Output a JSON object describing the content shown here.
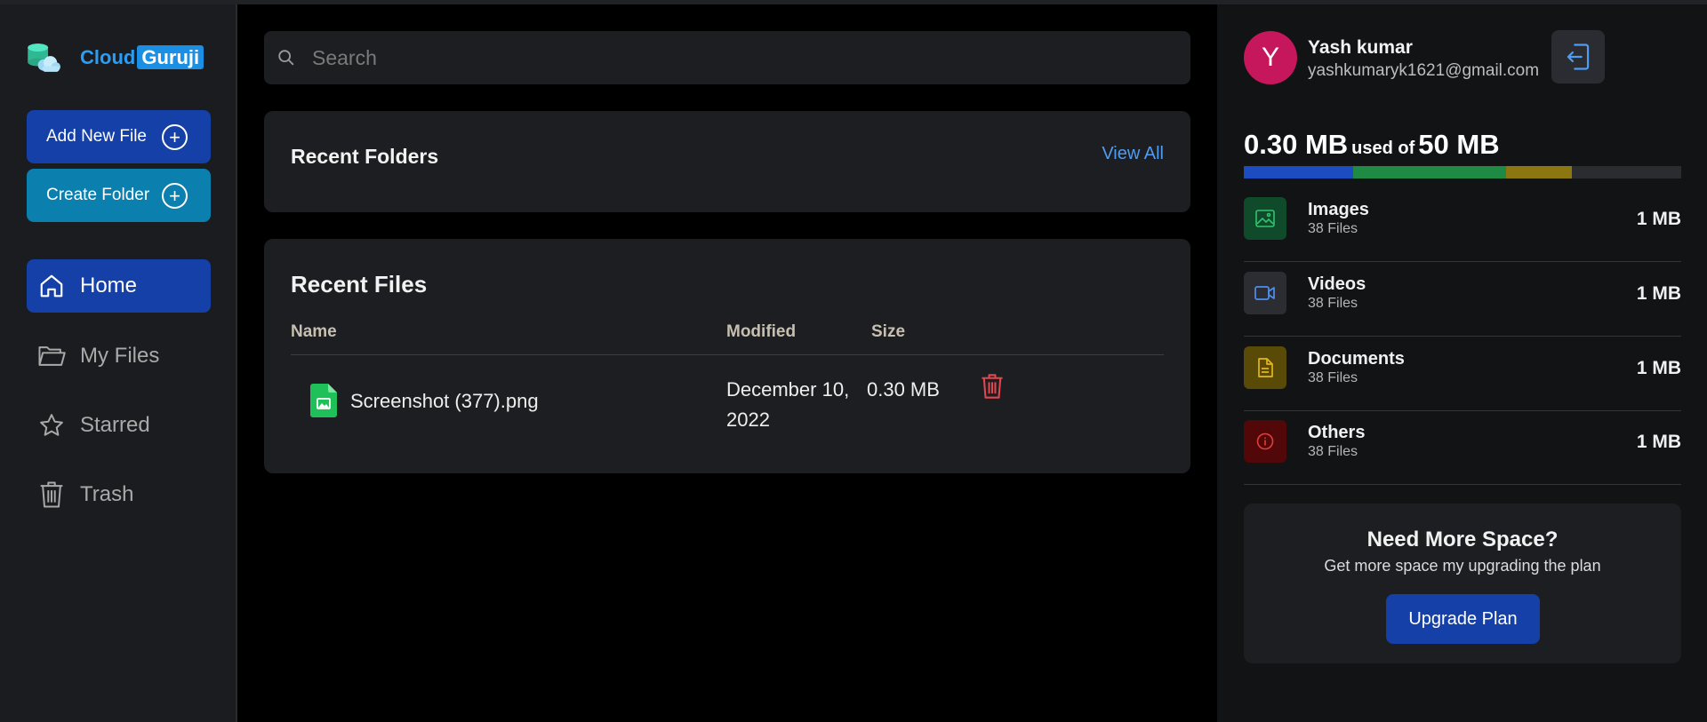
{
  "brand": {
    "part1": "Cloud",
    "part2": "Guruji"
  },
  "sidebar": {
    "add_file_label": "Add New File",
    "create_folder_label": "Create Folder",
    "nav": [
      {
        "label": "Home",
        "icon": "home-icon",
        "active": true
      },
      {
        "label": "My Files",
        "icon": "folder-icon"
      },
      {
        "label": "Starred",
        "icon": "star-icon"
      },
      {
        "label": "Trash",
        "icon": "trash-icon"
      }
    ]
  },
  "search": {
    "placeholder": "Search",
    "value": ""
  },
  "recent_folders": {
    "title": "Recent Folders",
    "view_all": "View All"
  },
  "recent_files": {
    "title": "Recent Files",
    "columns": [
      "Name",
      "Modified",
      "Size"
    ],
    "rows": [
      {
        "name": "Screenshot (377).png",
        "modified": "December 10, 2022",
        "size": "0.30 MB",
        "icon": "image-file-icon"
      }
    ]
  },
  "user": {
    "initial": "Y",
    "name": "Yash kumar",
    "email": "yashkumaryk1621@gmail.com"
  },
  "storage": {
    "used": "0.30 MB",
    "used_of": "used of",
    "total": "50 MB",
    "bar_fractions": [
      {
        "fraction": 0.25,
        "color": "#1d4cc0"
      },
      {
        "fraction": 0.35,
        "color": "#1e8a44"
      },
      {
        "fraction": 0.15,
        "color": "#8c7610"
      }
    ],
    "categories": [
      {
        "name": "Images",
        "count": "38 Files",
        "size": "1 MB",
        "icon": "image-icon",
        "bg": "#0f4a2a",
        "fg": "#35c26f"
      },
      {
        "name": "Videos",
        "count": "38 Files",
        "size": "1 MB",
        "icon": "video-icon",
        "bg": "#2b2d33",
        "fg": "#4f8ff0"
      },
      {
        "name": "Documents",
        "count": "38 Files",
        "size": "1 MB",
        "icon": "document-icon",
        "bg": "#5a4a07",
        "fg": "#e3b721"
      },
      {
        "name": "Others",
        "count": "38 Files",
        "size": "1 MB",
        "icon": "info-icon",
        "bg": "#520808",
        "fg": "#e23d3d"
      }
    ]
  },
  "upgrade": {
    "title": "Need More Space?",
    "subtitle": "Get more space my upgrading the plan",
    "button": "Upgrade Plan"
  }
}
